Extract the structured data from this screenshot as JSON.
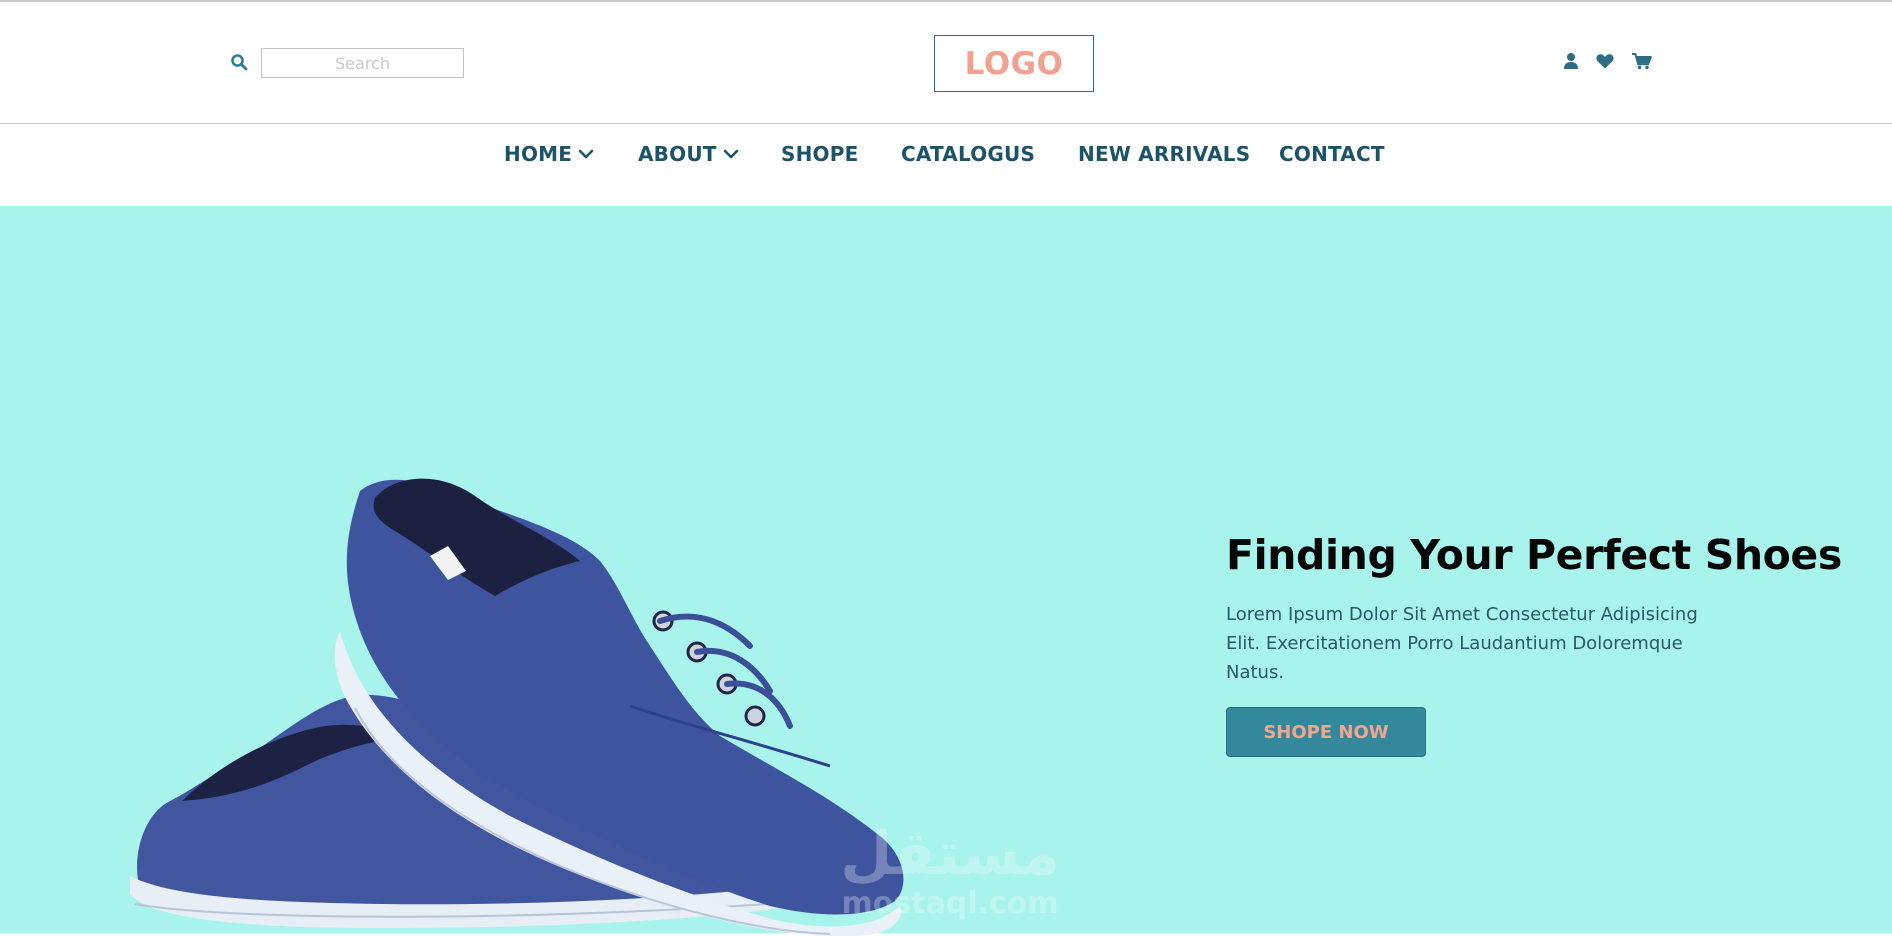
{
  "header": {
    "search": {
      "placeholder": "Search",
      "value": ""
    },
    "logo_text": "LOGO",
    "icons": [
      "user-icon",
      "heart-icon",
      "cart-icon"
    ]
  },
  "nav": {
    "items": [
      {
        "label": "HOME",
        "has_dropdown": true
      },
      {
        "label": "ABOUT",
        "has_dropdown": true
      },
      {
        "label": "SHOPE",
        "has_dropdown": false
      },
      {
        "label": "CATALOGUS",
        "has_dropdown": false
      },
      {
        "label": "NEW ARRIVALS",
        "has_dropdown": false
      },
      {
        "label": "CONTACT",
        "has_dropdown": false
      }
    ]
  },
  "hero": {
    "title": "Finding Your Perfect Shoes",
    "text": "Lorem Ipsum Dolor Sit Amet Consectetur Adipisicing Elit. Exercitationem Porro Laudantium Doloremque Natus.",
    "cta_label": "SHOPE NOW"
  },
  "watermark": {
    "arabic": "مستقل",
    "latin": "mostaql.com"
  },
  "colors": {
    "hero_bg": "#a8f3ec",
    "accent_dark": "#1d5366",
    "button_bg": "#33889b",
    "button_text": "#f3a592",
    "logo_text": "#f2a08f",
    "logo_border": "#2e6d83"
  }
}
